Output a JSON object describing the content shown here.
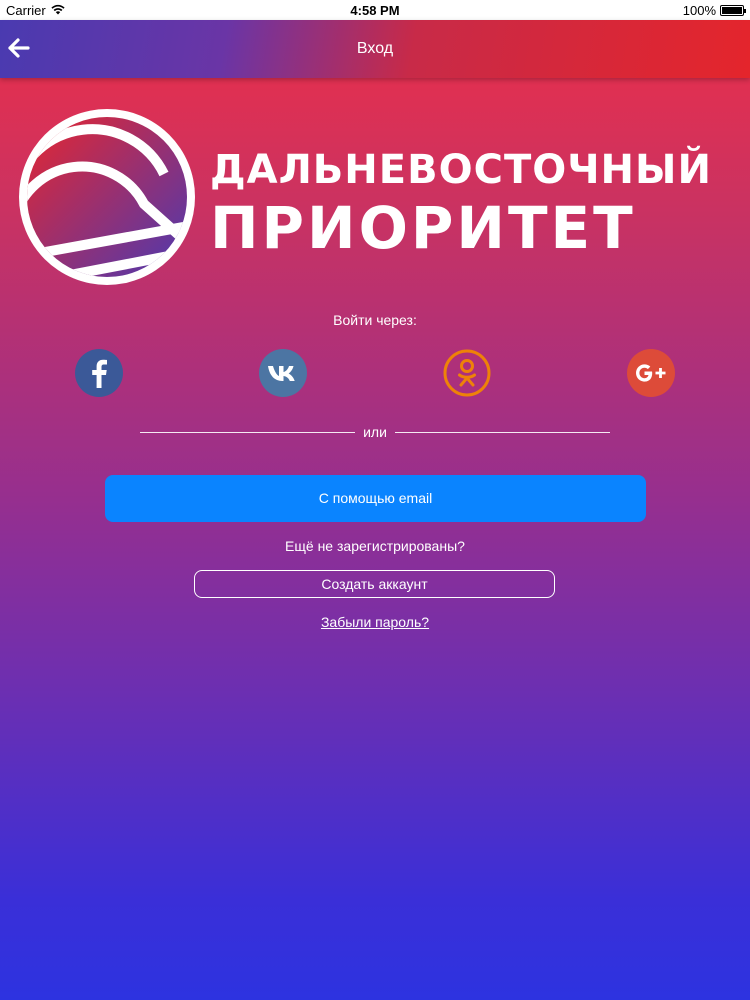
{
  "status_bar": {
    "carrier": "Carrier",
    "time": "4:58 PM",
    "battery_text": "100%",
    "battery_level": 1.0
  },
  "nav": {
    "title": "Вход",
    "back_icon": "arrow-left-icon"
  },
  "logo": {
    "line1": "ДАЛЬНЕВОСТОЧНЫЙ",
    "line2": "ПРИОРИТЕТ"
  },
  "login": {
    "via_label": "Войти через:",
    "social": [
      {
        "name": "facebook",
        "icon": "facebook-icon",
        "color": "#3b5998"
      },
      {
        "name": "vk",
        "icon": "vk-icon",
        "color": "#4c75a3"
      },
      {
        "name": "odnoklassniki",
        "icon": "odnoklassniki-icon",
        "color": "#ee8208"
      },
      {
        "name": "google-plus",
        "icon": "google-plus-icon",
        "color": "#dd4b39"
      }
    ],
    "divider_text": "или",
    "email_button": "С помощью email",
    "not_registered": "Ещё не зарегистрированы?",
    "create_account": "Создать аккаунт",
    "forgot_password": "Забыли пароль?"
  },
  "colors": {
    "primary_button": "#0a84ff",
    "gradient_top": "#ee2f47",
    "gradient_bottom": "#2d33e0"
  }
}
